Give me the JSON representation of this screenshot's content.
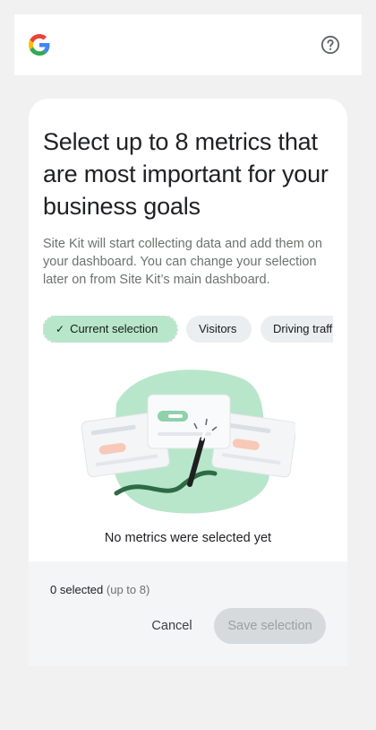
{
  "header": {
    "logo_icon": "google-g-logo",
    "help_icon": "help-circle-icon"
  },
  "main": {
    "title": "Select up to 8 metrics that are most important for your business goals",
    "description": "Site Kit will start collecting data and add them on your dashboard. You can change your selection later on from Site Kit’s main dashboard.",
    "chips": [
      {
        "label": "Current selection",
        "selected": true,
        "icon": "check-icon"
      },
      {
        "label": "Visitors",
        "selected": false
      },
      {
        "label": "Driving traffic",
        "selected": false
      }
    ],
    "empty_message": "No metrics were selected yet"
  },
  "footer": {
    "selected_count": "0 selected",
    "limit_text": "(up to 8)",
    "cancel_label": "Cancel",
    "save_label": "Save selection"
  },
  "colors": {
    "accent_green": "#b8e6ca",
    "chip_bg": "#ebeef0",
    "disabled_button": "#d7dadd",
    "page_bg": "#f1f1f1"
  }
}
